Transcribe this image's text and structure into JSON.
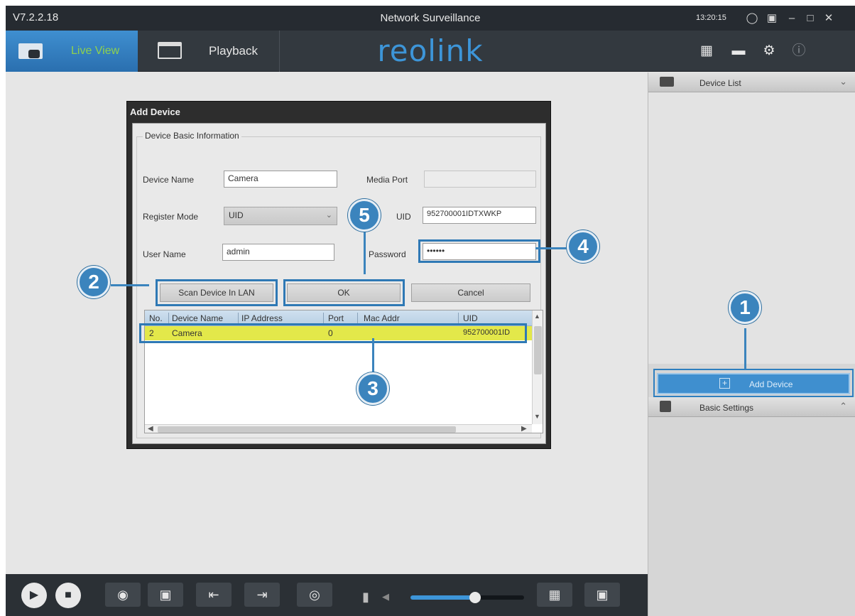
{
  "titlebar": {
    "version": "V7.2.2.18",
    "title": "Network Surveillance",
    "clock": "13:20:15",
    "icons": [
      "globe-icon",
      "network-icon",
      "minimize-icon",
      "maximize-icon",
      "close-icon"
    ]
  },
  "nav": {
    "live_view_label": "Live View",
    "playback_label": "Playback",
    "logo": "reolink",
    "icons": [
      "disk-icon",
      "device-manager-icon",
      "settings-icon",
      "info-icon"
    ]
  },
  "dialog": {
    "title": "Add Device",
    "group_title": "Device Basic Information",
    "labels": {
      "device_name": "Device Name",
      "register_mode": "Register Mode",
      "user_name": "User Name",
      "media_port": "Media Port",
      "uid": "UID",
      "password": "Password"
    },
    "values": {
      "device_name": "Camera",
      "register_mode": "UID",
      "user_name": "admin",
      "media_port": "",
      "uid": "952700001IDTXWKP",
      "password": "••••••"
    },
    "buttons": {
      "scan": "Scan Device In LAN",
      "ok": "OK",
      "cancel": "Cancel"
    },
    "list": {
      "columns": [
        "No.",
        "Device Name",
        "IP Address",
        "Port",
        "Mac Addr",
        "UID"
      ],
      "rows": [
        {
          "no": "2",
          "device_name": "Camera",
          "ip": "",
          "port": "0",
          "mac": "",
          "uid": "952700001ID"
        }
      ]
    }
  },
  "right_panel": {
    "device_list_label": "Device List",
    "add_device_label": "Add Device",
    "basic_settings_label": "Basic Settings"
  },
  "bottombar": {
    "volume_fraction": 0.57,
    "icons": [
      "play-icon",
      "stop-icon",
      "snapshot-icon",
      "record-icon",
      "previous-icon",
      "next-icon",
      "eye-icon",
      "microphone-icon",
      "speaker-icon",
      "layout-icon",
      "fullscreen-icon"
    ]
  },
  "steps": [
    "1",
    "2",
    "3",
    "4",
    "5"
  ],
  "colors": {
    "accent": "#3b84bd",
    "highlight_row": "#e3e84a",
    "live_view_text": "#8fd14f"
  }
}
